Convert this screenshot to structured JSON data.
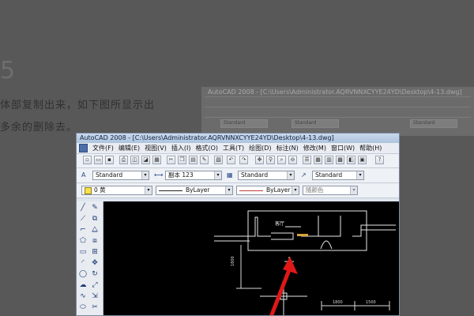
{
  "background": {
    "heading": "5",
    "lines": [
      "体部复制出来，如下图所显示出",
      "多余的删除去。"
    ]
  },
  "background_window": {
    "title": "AutoCAD 2008 - [C:\\Users\\Administrator.AQRVNNXCYYE24YD\\Desktop\\4-13.dwg]",
    "chips": [
      "Standard",
      "Standard",
      "Standard"
    ]
  },
  "window": {
    "title": "AutoCAD 2008 - [C:\\Users\\Administrator.AQRVNNXCYYE24YD\\Desktop\\4-13.dwg]"
  },
  "menu": [
    "文件(F)",
    "编辑(E)",
    "视图(V)",
    "插入(I)",
    "格式(O)",
    "工具(T)",
    "绘图(D)",
    "标注(N)",
    "修改(M)",
    "窗口(W)",
    "帮助(H)"
  ],
  "styles": {
    "text_style": "Standard",
    "dim_style": "副本 123",
    "table_style": "Standard",
    "mleader_style": "Standard"
  },
  "layers": {
    "current_layer": "0 黄",
    "linetype": "ByLayer",
    "lineweight": "ByLayer",
    "plot_style": "随颜色"
  },
  "drawing": {
    "label_a": "客厅",
    "dim_a": "1800",
    "dim_b": "1500"
  },
  "colors": {
    "arrow": "#e01818",
    "canvas": "#000000",
    "geometry": "#e8e8e8",
    "dimension": "#d8d8d8",
    "highlight": "#d6a43c"
  }
}
